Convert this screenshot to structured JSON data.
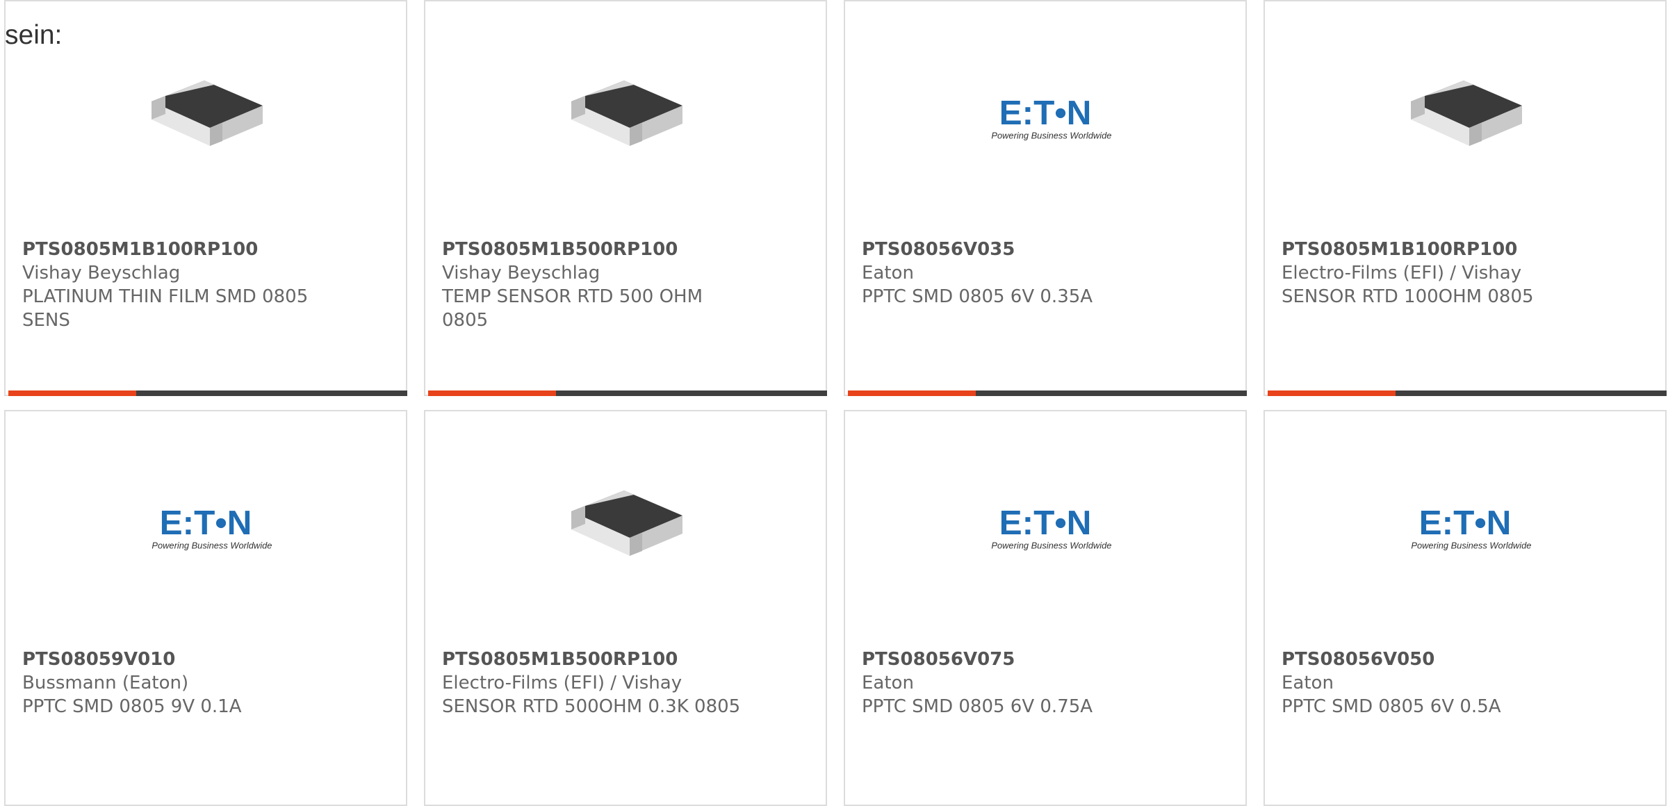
{
  "intro_text": "sein:",
  "colors": {
    "accent": "#e8431b",
    "bar_track": "#3f3f3f",
    "border": "#dcdcdc",
    "eaton_blue": "#1f6db5"
  },
  "products": [
    {
      "part": "PTS0805M1B100RP100",
      "manufacturer": "Vishay Beyschlag",
      "description": "PLATINUM THIN FILM SMD 0805 SENS",
      "image": "smd-chip-resistor-image",
      "progress": 0.32
    },
    {
      "part": "PTS0805M1B500RP100",
      "manufacturer": "Vishay Beyschlag",
      "description": "TEMP SENSOR RTD 500 OHM 0805",
      "image": "smd-chip-resistor-image",
      "progress": 0.32
    },
    {
      "part": "PTS08056V035",
      "manufacturer": "Eaton",
      "description": "PPTC SMD 0805 6V 0.35A",
      "image": "eaton-logo",
      "progress": 0.32,
      "logo_tagline": "Powering Business Worldwide"
    },
    {
      "part": "PTS0805M1B100RP100",
      "manufacturer": "Electro-Films (EFI) / Vishay",
      "description": "SENSOR RTD 100OHM 0805",
      "image": "smd-chip-resistor-image",
      "progress": 0.32
    },
    {
      "part": "PTS08059V010",
      "manufacturer": "Bussmann (Eaton)",
      "description": "PPTC SMD 0805 9V 0.1A",
      "image": "eaton-logo",
      "logo_tagline": "Powering Business Worldwide"
    },
    {
      "part": "PTS0805M1B500RP100",
      "manufacturer": "Electro-Films (EFI) / Vishay",
      "description": "SENSOR RTD 500OHM 0.3K 0805",
      "image": "smd-chip-resistor-image"
    },
    {
      "part": "PTS08056V075",
      "manufacturer": "Eaton",
      "description": "PPTC SMD 0805 6V 0.75A",
      "image": "eaton-logo",
      "logo_tagline": "Powering Business Worldwide"
    },
    {
      "part": "PTS08056V050",
      "manufacturer": "Eaton",
      "description": "PPTC SMD 0805 6V 0.5A",
      "image": "eaton-logo",
      "logo_tagline": "Powering Business Worldwide"
    }
  ]
}
